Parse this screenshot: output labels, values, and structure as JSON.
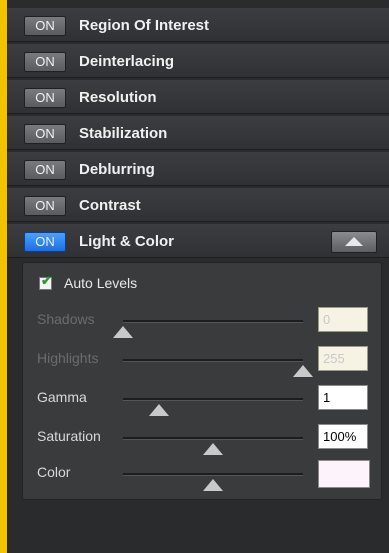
{
  "sections": [
    {
      "toggle": "ON",
      "title": "Region Of Interest",
      "active": false
    },
    {
      "toggle": "ON",
      "title": "Deinterlacing",
      "active": false
    },
    {
      "toggle": "ON",
      "title": "Resolution",
      "active": false
    },
    {
      "toggle": "ON",
      "title": "Stabilization",
      "active": false
    },
    {
      "toggle": "ON",
      "title": "Deblurring",
      "active": false
    },
    {
      "toggle": "ON",
      "title": "Contrast",
      "active": false
    },
    {
      "toggle": "ON",
      "title": "Light & Color",
      "active": true,
      "expanded": true
    }
  ],
  "light_color": {
    "auto_levels": {
      "label": "Auto Levels",
      "checked": true,
      "check_icon": "checkmark-icon"
    },
    "sliders": [
      {
        "label": "Shadows",
        "value": "0",
        "level": 0.0,
        "enabled": false
      },
      {
        "label": "Highlights",
        "value": "255",
        "level": 1.0,
        "enabled": false
      },
      {
        "label": "Gamma",
        "value": "1",
        "level": 0.2,
        "enabled": true
      },
      {
        "label": "Saturation",
        "value": "100%",
        "level": 0.5,
        "enabled": true
      }
    ],
    "color": {
      "label": "Color",
      "level": 0.5,
      "swatch": "#fcf4fa"
    }
  },
  "colors": {
    "accent": "#2f86f5",
    "panel": "#2a2b2d",
    "frame": "#f3c200"
  },
  "icons": {
    "expand": "triangle-up-icon",
    "slider_thumb": "triangle-up-icon"
  }
}
